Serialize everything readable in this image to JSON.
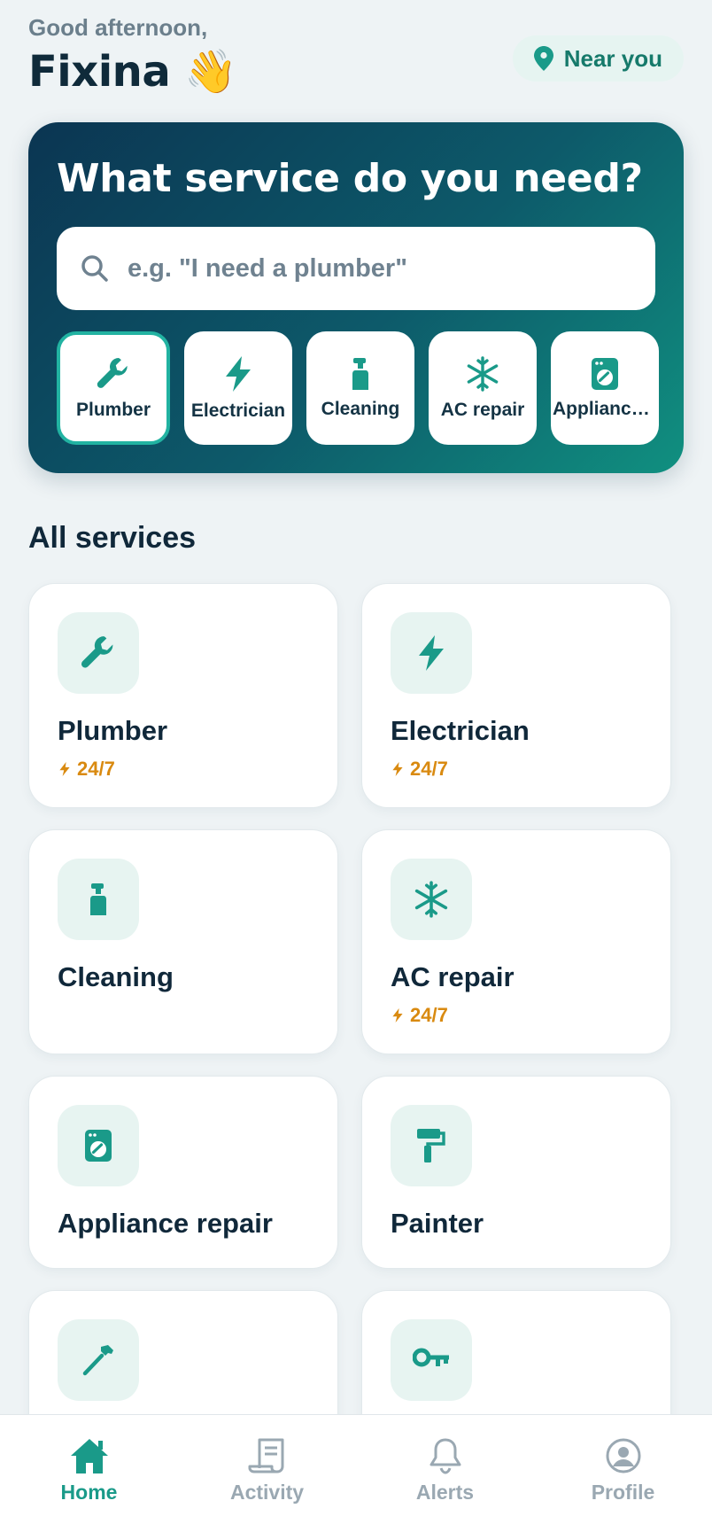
{
  "header": {
    "greeting": "Good afternoon,",
    "user_name": "Fixina 👋",
    "location_label": "Near you"
  },
  "hero": {
    "title": "What service do you need?",
    "search_placeholder": "e.g. \"I need a plumber\"",
    "chips": [
      {
        "label": "Plumber",
        "icon": "wrench-icon",
        "active": true
      },
      {
        "label": "Electrician",
        "icon": "bolt-icon",
        "active": false
      },
      {
        "label": "Cleaning",
        "icon": "spray-bottle-icon",
        "active": false
      },
      {
        "label": "AC repair",
        "icon": "snowflake-icon",
        "active": false
      },
      {
        "label": "Appliance repair",
        "icon": "washing-machine-icon",
        "active": false
      }
    ]
  },
  "services": {
    "title": "All services",
    "items": [
      {
        "name": "Plumber",
        "icon": "wrench-icon",
        "badge": "24/7"
      },
      {
        "name": "Electrician",
        "icon": "bolt-icon",
        "badge": "24/7"
      },
      {
        "name": "Cleaning",
        "icon": "spray-bottle-icon",
        "badge": ""
      },
      {
        "name": "AC repair",
        "icon": "snowflake-icon",
        "badge": "24/7"
      },
      {
        "name": "Appliance repair",
        "icon": "washing-machine-icon",
        "badge": ""
      },
      {
        "name": "Painter",
        "icon": "paint-roller-icon",
        "badge": ""
      },
      {
        "name": "",
        "icon": "hammer-icon",
        "badge": ""
      },
      {
        "name": "",
        "icon": "key-icon",
        "badge": ""
      }
    ]
  },
  "nav": {
    "items": [
      {
        "label": "Home",
        "icon": "home-icon",
        "active": true
      },
      {
        "label": "Activity",
        "icon": "receipt-icon",
        "active": false
      },
      {
        "label": "Alerts",
        "icon": "bell-icon",
        "active": false
      },
      {
        "label": "Profile",
        "icon": "profile-icon",
        "active": false
      }
    ]
  },
  "colors": {
    "accent": "#1a9a89",
    "hero_start": "#0b3552",
    "hero_end": "#109080",
    "badge": "#d98a10",
    "background": "#eef3f5"
  }
}
